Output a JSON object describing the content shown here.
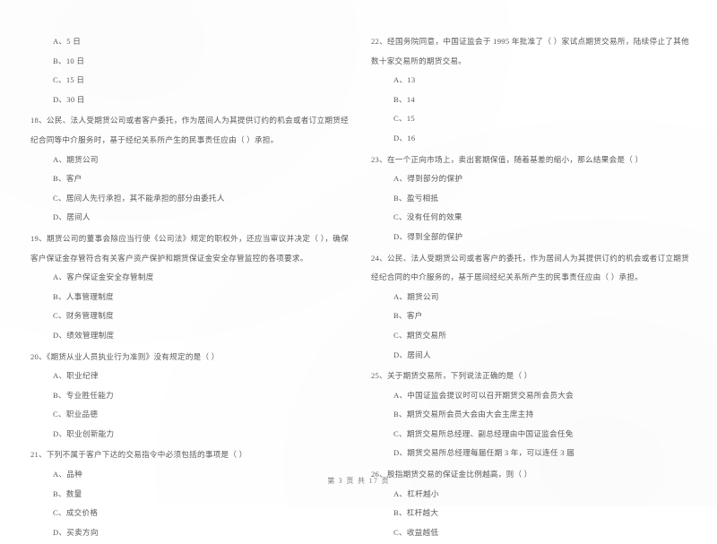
{
  "document": {
    "type": "exam-paper",
    "language": "zh-CN",
    "subject_hint": "期货从业资格考试 单项选择题",
    "text_color": "#5a5a5a",
    "background_color": "#ffffff"
  },
  "footer": {
    "page_label": "第 3 页  共 17 页"
  },
  "columns": {
    "left": [
      {
        "id": "orphan-options-17",
        "stem": "",
        "options": [
          "A、5 日",
          "B、10 日",
          "C、15 日",
          "D、30 日"
        ]
      },
      {
        "id": "q18",
        "stem": "18、公民、法人受期货公司或者客户委托，作为居间人为其提供订约的机会或者订立期货经纪合同等中介服务时，基于经纪关系所产生的民事责任应由（      ）承担。",
        "options": [
          "A、期货公司",
          "B、客户",
          "C、居间人先行承担，其不能承担的部分由委托人",
          "D、居间人"
        ]
      },
      {
        "id": "q19",
        "stem": "19、期货公司的董事会除应当行使《公司法》规定的职权外，还应当审议并决定（      ），确保客户保证金存管符合有关客户资产保护和期货保证金安全存管监控的各项要求。",
        "options": [
          "A、客户保证金安全存管制度",
          "B、人事管理制度",
          "C、财务管理制度",
          "D、绩效管理制度"
        ]
      },
      {
        "id": "q20",
        "stem": "20、《期货从业人员执业行为准则》没有规定的是（      ）",
        "options": [
          "A、职业纪律",
          "B、专业胜任能力",
          "C、职业品德",
          "D、职业创新能力"
        ]
      },
      {
        "id": "q21",
        "stem": "21、下列不属于客户下达的交易指令中必须包括的事项是（      ）",
        "options": [
          "A、品种",
          "B、数量",
          "C、成交价格",
          "D、买卖方向"
        ]
      }
    ],
    "right": [
      {
        "id": "q22",
        "stem": "22、经国务院同意，中国证监会于 1995 年批准了（      ）家试点期货交易所，陆续停止了其他数十家交易所的期货交易。",
        "options": [
          "A、13",
          "B、14",
          "C、15",
          "D、16"
        ]
      },
      {
        "id": "q23",
        "stem": "23、在一个正向市场上，卖出套期保值，随着基差的缩小，那么结果会是（      ）",
        "options": [
          "A、得到部分的保护",
          "B、盈亏相抵",
          "C、没有任何的效果",
          "D、得到全部的保护"
        ]
      },
      {
        "id": "q24",
        "stem": "24、公民、法人受期货公司或者客户的委托，作为居间人为其提供订约的机会或者订立期货经纪合同的中介服务的，基于居间经纪关系所产生的民事责任应由（      ）承担。",
        "options": [
          "A、期货公司",
          "B、客户",
          "C、期货交易所",
          "D、居间人"
        ]
      },
      {
        "id": "q25",
        "stem": "25、关于期货交易所，下列说法正确的是（      ）",
        "options": [
          "A、中国证监会提议时可以召开期货交易所会员大会",
          "B、期货交易所会员大会由大会主席主持",
          "C、期货交易所总经理、副总经理由中国证监会任免",
          "D、期货交易所总经理每届任期 3 年，可以连任 3 届"
        ]
      },
      {
        "id": "q26",
        "stem": "26、股指期货交易的保证金比例越高，则（      ）",
        "options": [
          "A、杠杆越小",
          "B、杠杆越大",
          "C、收益越低"
        ]
      }
    ]
  }
}
